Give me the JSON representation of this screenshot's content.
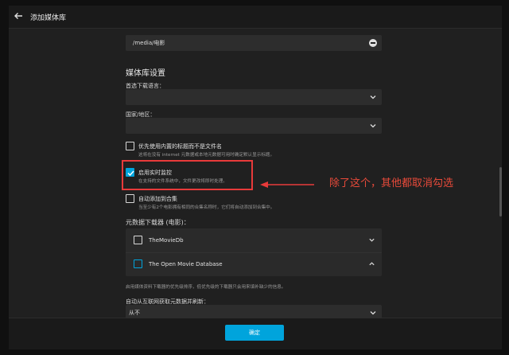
{
  "header": {
    "title": "添加媒体库"
  },
  "folder": {
    "path": "/media/电影"
  },
  "library_settings": {
    "section_title": "媒体库设置",
    "preferred_language_label": "首选下载语言：",
    "preferred_language_value": "",
    "country_label": "国家/地区：",
    "country_value": ""
  },
  "options": [
    {
      "label": "优先使用内置的标题而不是文件名",
      "desc": "这将在没有 internet 元数据或本地元数据可用时确定默认显示标题。",
      "checked": false
    },
    {
      "label": "启用实时监控",
      "desc": "在支持的文件系统中，文件更改将即时处理。",
      "checked": true
    },
    {
      "label": "自动添加到合集",
      "desc": "当至少有2个电影拥有相同的合集名称时，它们将自动添加到合集中。",
      "checked": false
    }
  ],
  "metadata_fetchers": {
    "title": "元数据下载器 (电影)：",
    "items": [
      {
        "name": "TheMovieDb",
        "checked": false,
        "expanded": false
      },
      {
        "name": "The Open Movie Database",
        "checked": false,
        "expanded": true
      }
    ],
    "desc": "启用媒体资料下载器的优先级排序，低优先级的下载器只会用来填补缺少的信息。"
  },
  "refresh": {
    "label": "自动从互联网获取元数据并刷新：",
    "value": "从不"
  },
  "footer": {
    "confirm_label": "确定"
  },
  "annotation": {
    "text": "除了这个，其他都取消勾选",
    "color": "#e83a3a"
  },
  "colors": {
    "accent": "#00a4dc",
    "background": "#202020"
  }
}
